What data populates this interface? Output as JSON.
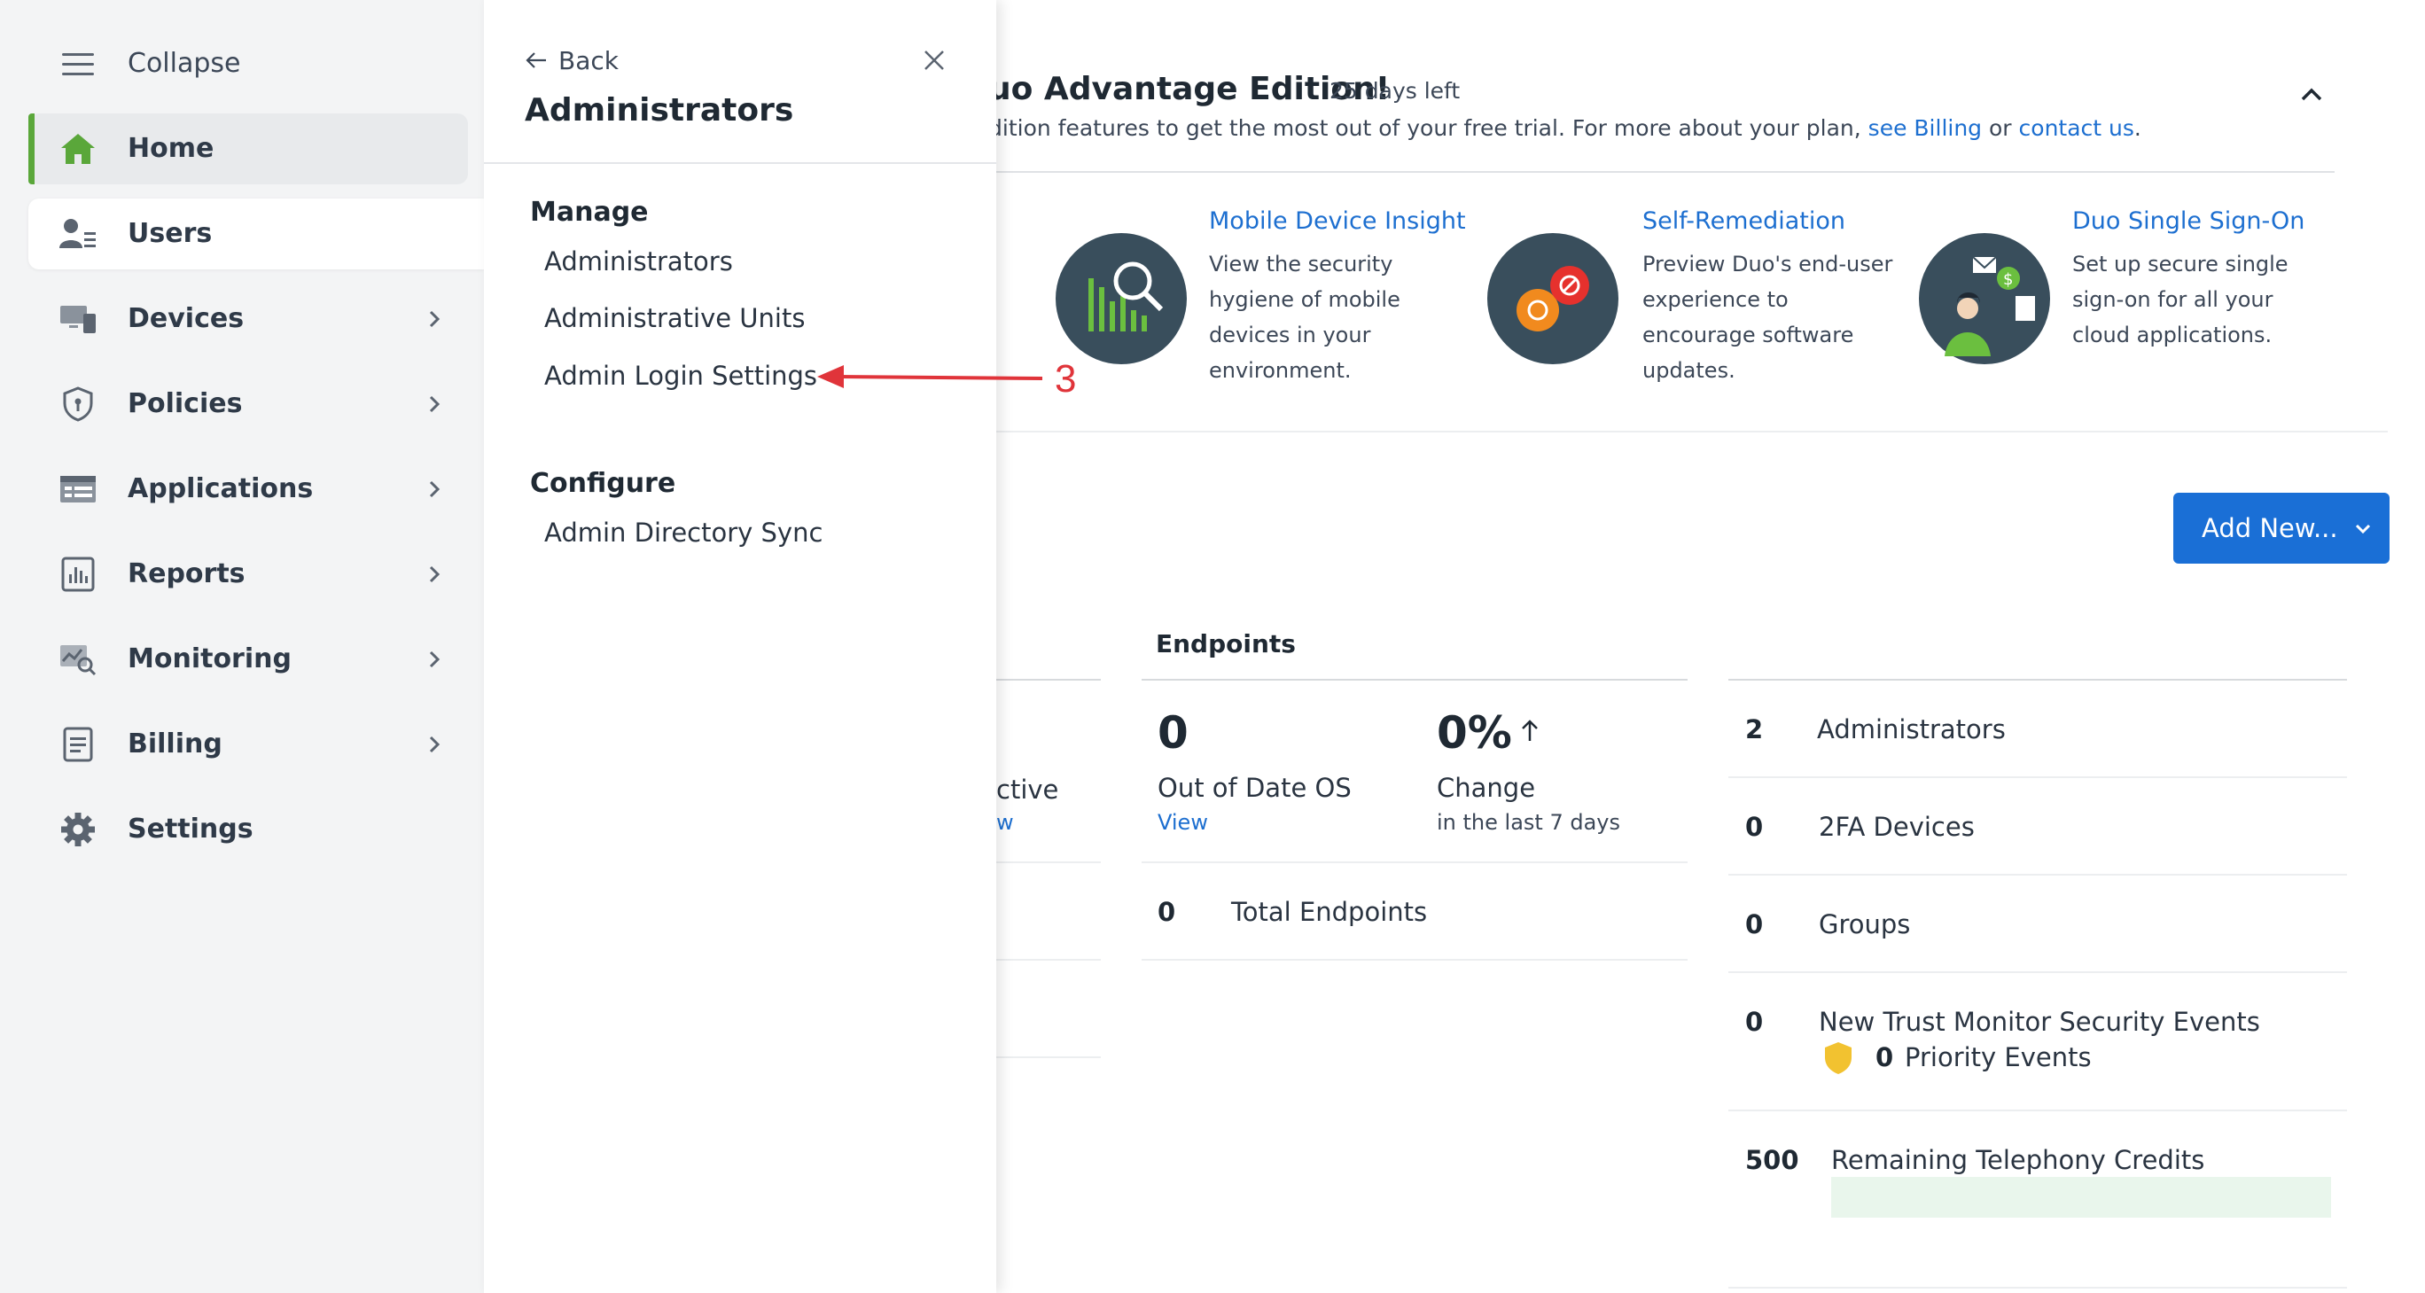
{
  "sidebar": {
    "collapse_label": "Collapse",
    "items": [
      {
        "label": "Home",
        "icon": "home-icon"
      },
      {
        "label": "Users",
        "icon": "users-icon"
      },
      {
        "label": "Devices",
        "icon": "devices-icon"
      },
      {
        "label": "Policies",
        "icon": "shield-icon"
      },
      {
        "label": "Applications",
        "icon": "applications-icon"
      },
      {
        "label": "Reports",
        "icon": "reports-icon"
      },
      {
        "label": "Monitoring",
        "icon": "monitoring-icon"
      },
      {
        "label": "Billing",
        "icon": "billing-icon"
      },
      {
        "label": "Settings",
        "icon": "gear-icon"
      }
    ]
  },
  "flyout": {
    "back_label": "Back",
    "title": "Administrators",
    "manage_heading": "Manage",
    "manage_links": [
      "Administrators",
      "Administrative Units",
      "Admin Login Settings"
    ],
    "configure_heading": "Configure",
    "configure_links": [
      "Admin Directory Sync"
    ]
  },
  "annotation": {
    "label": "3",
    "color": "#e0343a"
  },
  "banner": {
    "title": "uo Advantage Edition!",
    "trial_days": "25 days left",
    "desc_prefix": "dition features to get the most out of your free trial. For more about your plan,",
    "billing_link": "see Billing",
    "desc_or": "or",
    "contact_link": "contact us",
    "desc_suffix": "."
  },
  "features": [
    {
      "title": "Mobile Device Insight",
      "desc": "View the security hygiene of mobile devices in your environment."
    },
    {
      "title": "Self-Remediation",
      "desc": "Preview Duo's end-user experience to encourage software updates."
    },
    {
      "title": "Duo Single Sign-On",
      "desc": "Set up secure single sign-on for all your cloud applications."
    }
  ],
  "add_new_label": "Add New...",
  "left_card": {
    "partial_label": "ctive",
    "partial_link": "w"
  },
  "endpoints": {
    "heading": "Endpoints",
    "out_of_date_value": "0",
    "out_of_date_label": "Out of Date OS",
    "view_link": "View",
    "change_value": "0%",
    "change_label": "Change",
    "change_sub": "in the last 7 days",
    "total_value": "0",
    "total_label": "Total Endpoints"
  },
  "stats": {
    "admins_value": "2",
    "admins_label": "Administrators",
    "twofa_value": "0",
    "twofa_label": "2FA Devices",
    "groups_value": "0",
    "groups_label": "Groups",
    "trust_value": "0",
    "trust_label": "New Trust Monitor Security Events",
    "priority_value": "0",
    "priority_label": "Priority Events",
    "telephony_value": "500",
    "telephony_label": "Remaining Telephony Credits",
    "telephony_fill": 1.0
  },
  "colors": {
    "accent": "#1a6fd6",
    "brand_green": "#5aa73a",
    "link": "#1d6fd0"
  }
}
